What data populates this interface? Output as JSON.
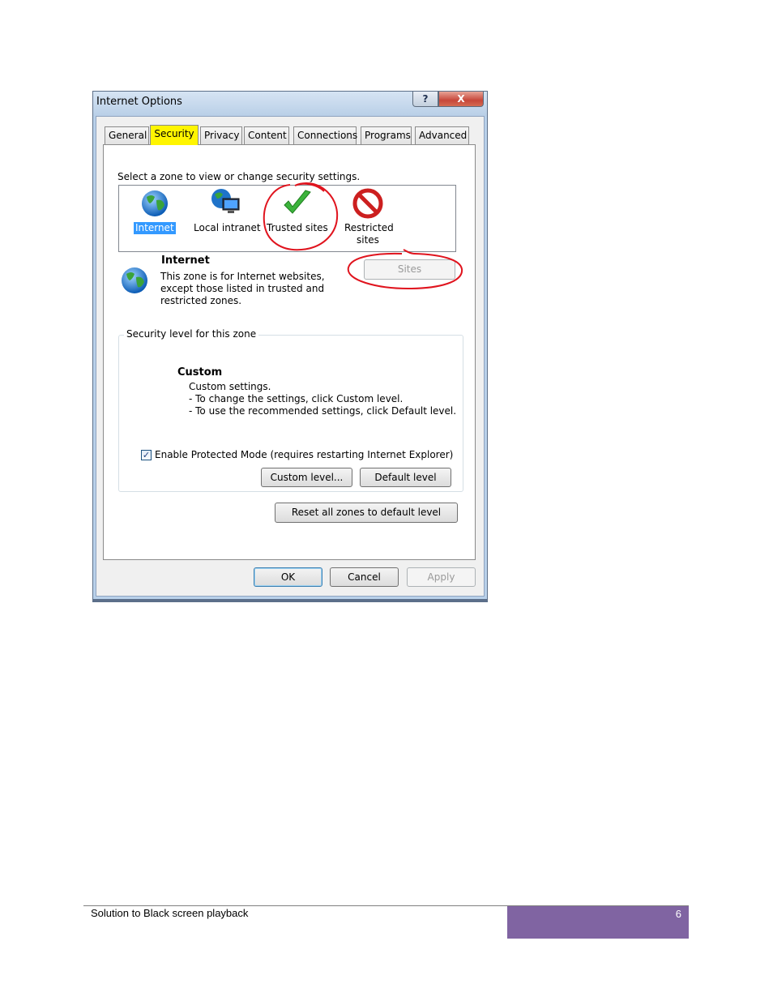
{
  "window": {
    "title": "Internet Options",
    "help_label": "?",
    "close_label": "X"
  },
  "tabs": [
    {
      "label": "General"
    },
    {
      "label": "Security",
      "active": true
    },
    {
      "label": "Privacy"
    },
    {
      "label": "Content"
    },
    {
      "label": "Connections"
    },
    {
      "label": "Programs"
    },
    {
      "label": "Advanced"
    }
  ],
  "security": {
    "zone_prompt": "Select a zone to view or change security settings.",
    "zones": [
      {
        "label": "Internet",
        "icon": "globe-icon",
        "selected": true
      },
      {
        "label": "Local intranet",
        "icon": "intranet-icon"
      },
      {
        "label": "Trusted sites",
        "icon": "checkmark-icon"
      },
      {
        "label_line1": "Restricted",
        "label_line2": "sites",
        "icon": "restricted-icon"
      }
    ],
    "zone_info": {
      "title": "Internet",
      "desc_line1": "This zone is for Internet websites,",
      "desc_line2": "except those listed in trusted and",
      "desc_line3": "restricted zones."
    },
    "sites_label": "Sites",
    "level_group_title": "Security level for this zone",
    "level": {
      "name": "Custom",
      "line1": "Custom settings.",
      "line2": "- To change the settings, click Custom level.",
      "line3": "- To use the recommended settings, click Default level."
    },
    "protected_mode": {
      "label": "Enable Protected Mode (requires restarting Internet Explorer)",
      "checked": true,
      "check_glyph": "✓"
    },
    "custom_level_label": "Custom level...",
    "default_level_label": "Default level",
    "reset_label": "Reset all zones to default level"
  },
  "dialog_buttons": {
    "ok": "OK",
    "cancel": "Cancel",
    "apply": "Apply"
  },
  "footer": {
    "left": "Solution to Black screen playback",
    "page": "6"
  },
  "colors": {
    "highlight": "#fff500",
    "selection": "#3399ff",
    "annotation": "#e0141e",
    "footer_box": "#8064a2"
  }
}
